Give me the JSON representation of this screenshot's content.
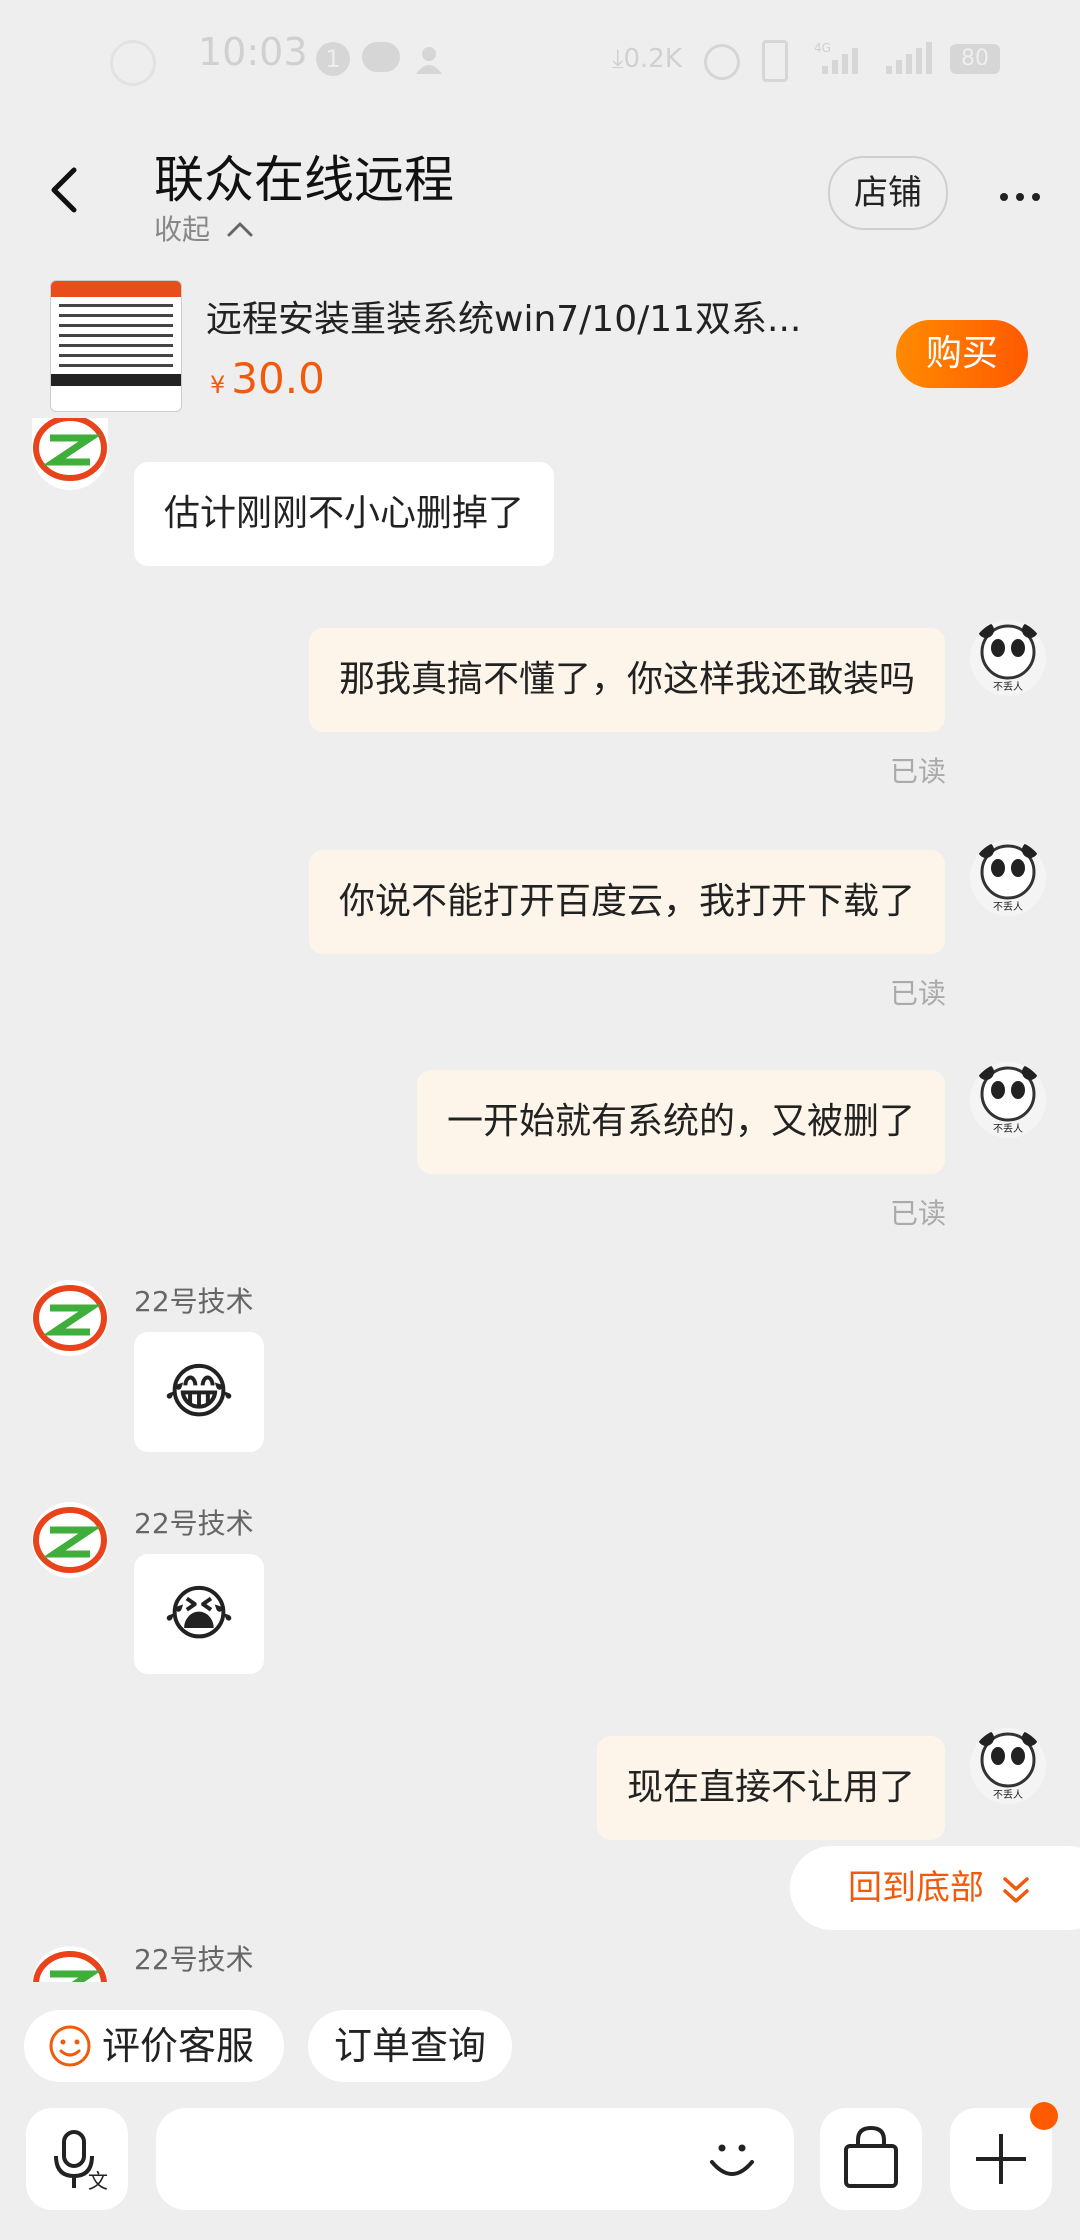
{
  "status_bar": {
    "time": "10:03",
    "notif_count": "1",
    "net_speed": "0.2K",
    "network": "4G",
    "battery": "80"
  },
  "header": {
    "title": "联众在线远程",
    "collapse_label": "收起",
    "shop_label": "店铺"
  },
  "product": {
    "title": "远程安装重装系统win7/10/11双系...",
    "currency": "¥",
    "price": "30.0",
    "buy_label": "购买"
  },
  "messages": [
    {
      "side": "left",
      "text": "估计刚刚不小心删掉了"
    },
    {
      "side": "right",
      "text": "那我真搞不懂了，你这样我还敢装吗",
      "status": "已读"
    },
    {
      "side": "right",
      "text": "你说不能打开百度云，我打开下载了",
      "status": "已读"
    },
    {
      "side": "right",
      "text": "一开始就有系统的，又被删了",
      "status": "已读"
    },
    {
      "side": "left",
      "sender": "22号技术",
      "emoji": "😂"
    },
    {
      "side": "left",
      "sender": "22号技术",
      "emoji": "😭"
    },
    {
      "side": "right",
      "text": "现在直接不让用了"
    },
    {
      "side": "left",
      "sender": "22号技术"
    }
  ],
  "avatar_caption": "不丢人",
  "back_to_bottom": "回到底部",
  "quick_actions": [
    {
      "label": "评价客服",
      "icon": "smile-icon"
    },
    {
      "label": "订单查询"
    }
  ],
  "colors": {
    "accent": "#f25a0b",
    "bubble_right": "#fdf5ea",
    "background": "#eeeeee"
  }
}
